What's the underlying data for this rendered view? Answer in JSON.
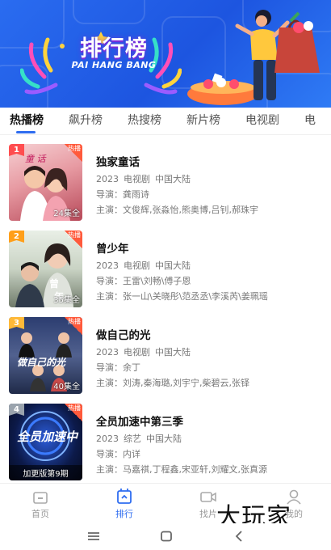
{
  "banner": {
    "title": "排行榜",
    "subtitle": "PAI HANG BANG"
  },
  "tabs": [
    "热播榜",
    "飙升榜",
    "热搜榜",
    "新片榜",
    "电视剧",
    "电"
  ],
  "active_tab": 0,
  "labels": {
    "director": "导演：",
    "cast": "主演：",
    "hot": "热播"
  },
  "items": [
    {
      "rank": "1",
      "title": "独家童话",
      "year": "2023",
      "genre": "电视剧",
      "region": "中国大陆",
      "director": "龚雨诗",
      "cast": "文俊辉,张淼怡,熊奥博,吕钊,郝珠宇",
      "episodes": "24集全",
      "rank_color": "#ff4d4f"
    },
    {
      "rank": "2",
      "title": "曾少年",
      "year": "2023",
      "genre": "电视剧",
      "region": "中国大陆",
      "director": "王雷\\刘畅\\傅子恩",
      "cast": "张一山\\关晓彤\\范丞丞\\李溪芮\\姜珮瑶",
      "episodes": "35集全",
      "rank_color": "#ff9f1a"
    },
    {
      "rank": "3",
      "title": "做自己的光",
      "year": "2023",
      "genre": "电视剧",
      "region": "中国大陆",
      "director": "余丁",
      "cast": "刘涛,秦海璐,刘宇宁,柴碧云,张铎",
      "episodes": "40集全",
      "rank_color": "#ffb938"
    },
    {
      "rank": "4",
      "title": "全员加速中第三季",
      "year": "2023",
      "genre": "综艺",
      "region": "中国大陆",
      "director": "内详",
      "cast": "马嘉祺,丁程鑫,宋亚轩,刘耀文,张真源",
      "episodes": "加更版第9期",
      "rank_color": "#9aa3ad"
    }
  ],
  "bottom_nav": [
    {
      "label": "首页",
      "icon": "home-icon"
    },
    {
      "label": "排行",
      "icon": "ranking-icon"
    },
    {
      "label": "找片",
      "icon": "video-camera-icon"
    },
    {
      "label": "我的",
      "icon": "user-icon"
    }
  ],
  "active_nav": 1,
  "watermark": "大玩家",
  "colors": {
    "accent": "#2f6df0",
    "banner": "#1f5ce6",
    "hot_badge": "#ff5a3c"
  }
}
